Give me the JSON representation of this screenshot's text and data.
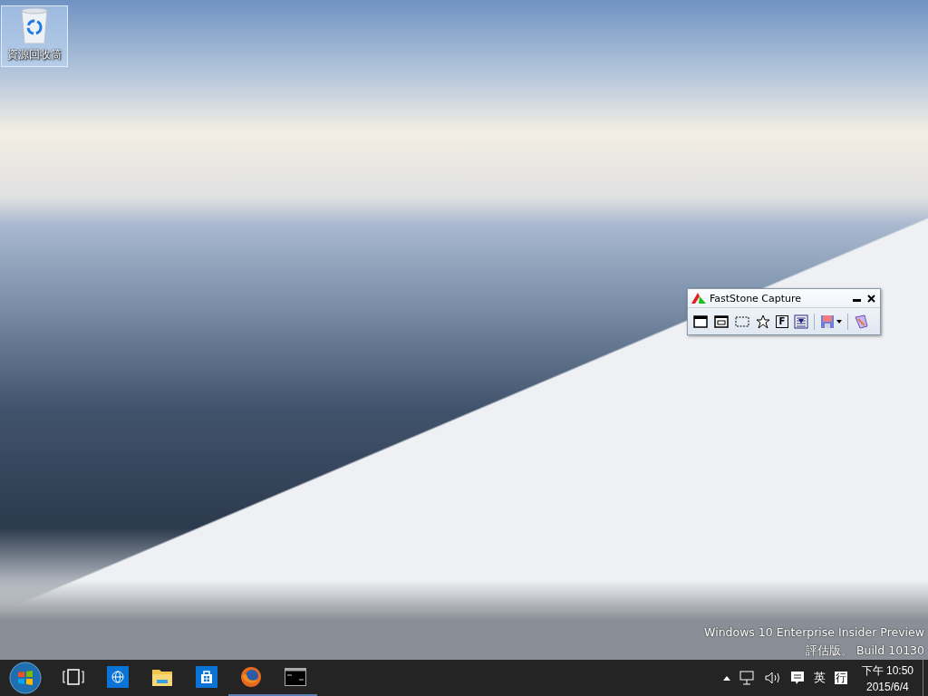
{
  "desktop": {
    "icons": [
      {
        "label": "資源回收筒",
        "selected": true
      }
    ],
    "watermark": [
      "Windows 10 Enterprise Insider Preview",
      "評估版。 Build 10130"
    ]
  },
  "capture_toolbar": {
    "title": "FastStone Capture",
    "tools": [
      {
        "kind": "window"
      },
      {
        "kind": "object"
      },
      {
        "kind": "rectangle"
      },
      {
        "kind": "freehand"
      },
      {
        "kind": "fullscreen",
        "glyph": "F"
      },
      {
        "kind": "scrolling"
      },
      {
        "kind": "separator"
      },
      {
        "kind": "save"
      },
      {
        "kind": "separator"
      },
      {
        "kind": "editor"
      }
    ]
  },
  "taskbar": {
    "apps": [
      {
        "kind": "task-view",
        "running": false
      },
      {
        "kind": "globe",
        "running": false
      },
      {
        "kind": "folder",
        "running": false
      },
      {
        "kind": "store",
        "running": false
      },
      {
        "kind": "firefox",
        "running": true
      },
      {
        "kind": "console",
        "running": true
      }
    ],
    "tray": {
      "ime": "英",
      "ime_mode": "行",
      "time": "下午 10:50",
      "date": "2015/6/4"
    }
  }
}
